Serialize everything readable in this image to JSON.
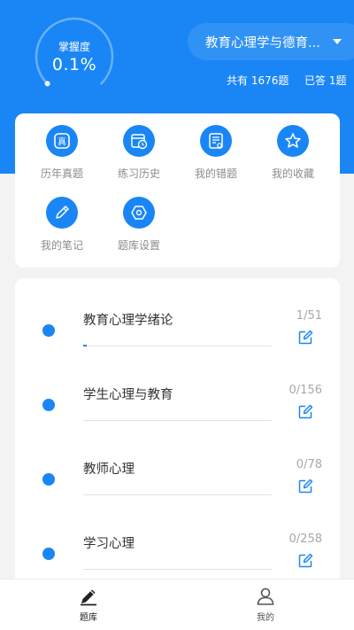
{
  "mastery": {
    "label": "掌握度",
    "value": "0.1%",
    "fraction": 0.001
  },
  "subject": {
    "name": "教育心理学与德育..."
  },
  "stats": {
    "total": "共有 1676题",
    "answered": "已答 1题"
  },
  "menu": [
    {
      "label": "历年真题",
      "icon": "real-exam-icon"
    },
    {
      "label": "练习历史",
      "icon": "calendar-history-icon"
    },
    {
      "label": "我的错题",
      "icon": "wrong-questions-icon"
    },
    {
      "label": "我的收藏",
      "icon": "star-icon"
    },
    {
      "label": "我的笔记",
      "icon": "pencil-icon"
    },
    {
      "label": "题库设置",
      "icon": "settings-hexagon-icon"
    }
  ],
  "chapters": [
    {
      "title": "教育心理学绪论",
      "count": "1/51",
      "progress": 0.0196
    },
    {
      "title": "学生心理与教育",
      "count": "0/156",
      "progress": 0
    },
    {
      "title": "教师心理",
      "count": "0/78",
      "progress": 0
    },
    {
      "title": "学习心理",
      "count": "0/258",
      "progress": 0
    }
  ],
  "tabs": [
    {
      "label": "题库",
      "icon": "pencil-icon",
      "active": true
    },
    {
      "label": "我的",
      "icon": "person-icon",
      "active": false
    }
  ],
  "colors": {
    "primary": "#1a86f5",
    "background": "#f3f3f3",
    "text": "#333333",
    "muted": "#8c8c8c"
  }
}
